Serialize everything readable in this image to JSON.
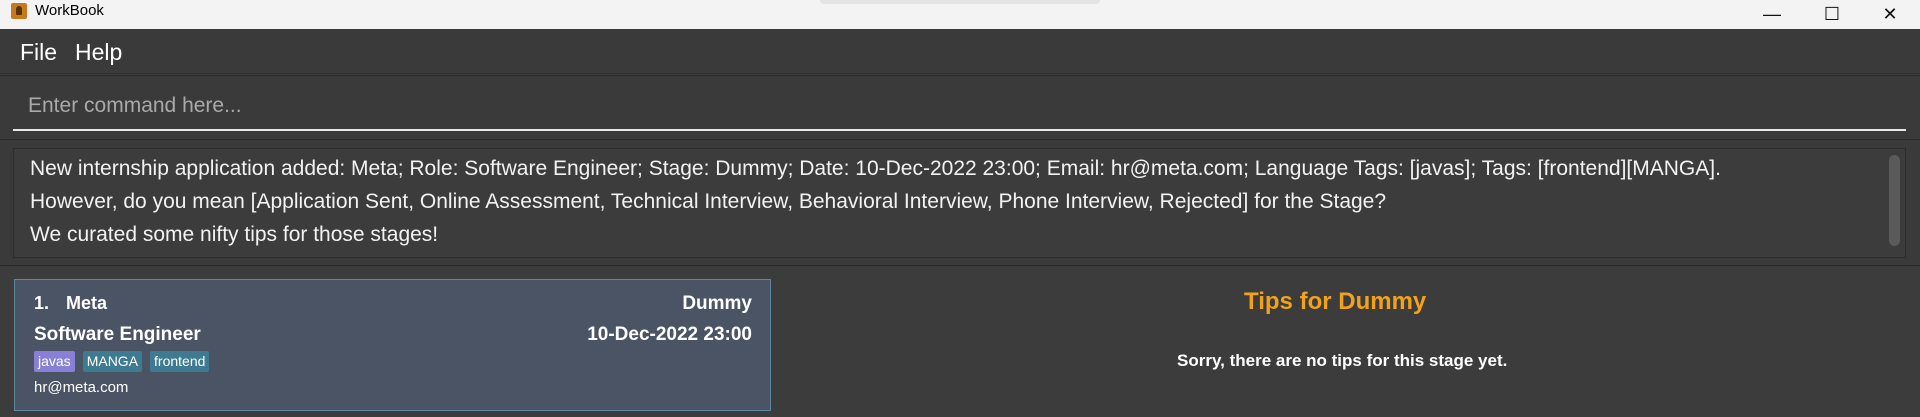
{
  "window": {
    "title": "WorkBook",
    "minimize_glyph": "—",
    "maximize_glyph": "☐",
    "close_glyph": "✕"
  },
  "menu": {
    "file": "File",
    "help": "Help"
  },
  "command": {
    "placeholder": "Enter command here..."
  },
  "result": {
    "lines": [
      "New internship application added: Meta; Role: Software Engineer; Stage: Dummy; Date: 10-Dec-2022 23:00; Email: hr@meta.com; Language Tags: [javas]; Tags: [frontend][MANGA].",
      "However, do you mean [Application Sent, Online Assessment, Technical Interview, Behavioral Interview, Phone Interview, Rejected] for the Stage?",
      "We curated some nifty tips for those stages!"
    ]
  },
  "applications": [
    {
      "index": "1.",
      "company": "Meta",
      "stage": "Dummy",
      "role": "Software Engineer",
      "date": "10-Dec-2022 23:00",
      "language_tags": [
        "javas"
      ],
      "tags": [
        "MANGA",
        "frontend"
      ],
      "email": "hr@meta.com"
    }
  ],
  "tips": {
    "title": "Tips for Dummy",
    "message": "Sorry, there are no tips for this stage yet."
  },
  "colors": {
    "background": "#3c3c3c",
    "card": "#4a5465",
    "card_border": "#5b8aa0",
    "tips_title": "#f2a21a",
    "language_tag": "#8880d6",
    "tag": "#3e7b91"
  },
  "icons": {
    "app": "workbook-app-icon"
  }
}
